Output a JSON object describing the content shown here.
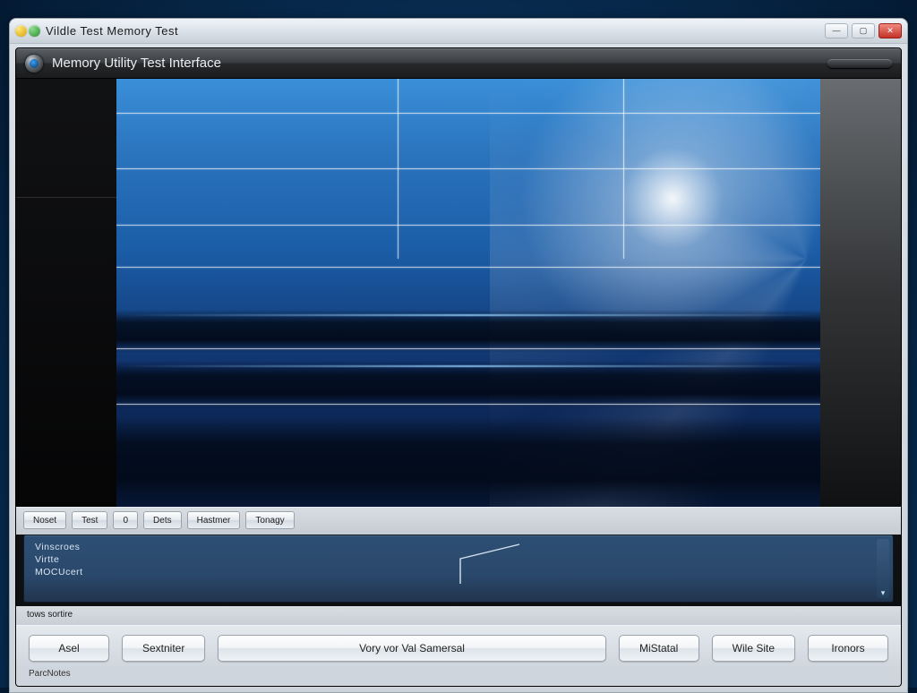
{
  "window": {
    "title": "Vildle Test Memory Test"
  },
  "header": {
    "title": "Memory Utility Test Interface"
  },
  "tabs": [
    {
      "label": "Noset"
    },
    {
      "label": "Test"
    },
    {
      "label": "0"
    },
    {
      "label": "Dets"
    },
    {
      "label": "Hastmer"
    },
    {
      "label": "Tonagy"
    }
  ],
  "info": {
    "line1": "Vinscroes",
    "line2": "Virtte",
    "line3": "MOCUcert"
  },
  "status": {
    "label": "tows sortire"
  },
  "buttons": {
    "b1": "Asel",
    "b2": "Sextniter",
    "b3": "Vory vor Val Samersal",
    "b4": "MiStatal",
    "b5": "Wile Site",
    "b6": "Ironors"
  },
  "footer": {
    "label": "ParcNotes"
  },
  "colors": {
    "accent": "#2a73bd"
  }
}
